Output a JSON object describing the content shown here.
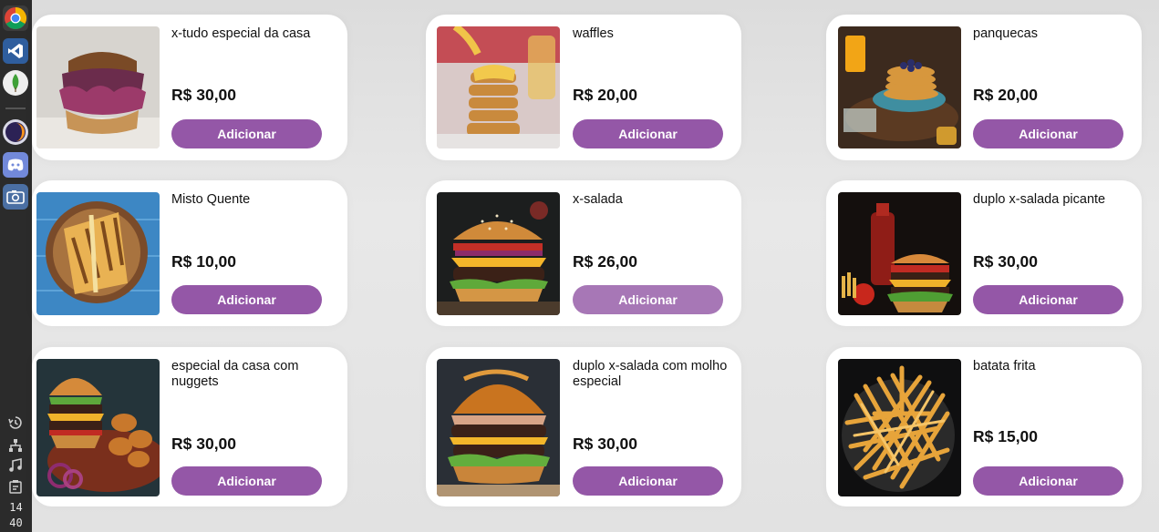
{
  "clock": {
    "hour": "14",
    "minute": "40"
  },
  "dock": {
    "apps": [
      {
        "name": "chrome-icon"
      },
      {
        "name": "vscode-icon"
      },
      {
        "name": "mongodb-icon"
      },
      {
        "name": "eclipse-icon"
      },
      {
        "name": "discord-icon"
      },
      {
        "name": "screenshot-icon"
      }
    ],
    "system": [
      {
        "name": "history-icon"
      },
      {
        "name": "network-icon"
      },
      {
        "name": "music-icon"
      },
      {
        "name": "clipboard-icon"
      }
    ]
  },
  "products": [
    {
      "name": "x-tudo especial da casa",
      "price": "R$ 30,00",
      "button": "Adicionar",
      "image": "burger-purple-slaw"
    },
    {
      "name": "waffles",
      "price": "R$ 20,00",
      "button": "Adicionar",
      "image": "waffle-stack-syrup"
    },
    {
      "name": "panquecas",
      "price": "R$ 20,00",
      "button": "Adicionar",
      "image": "pancakes-blueberries"
    },
    {
      "name": "Misto Quente",
      "price": "R$ 10,00",
      "button": "Adicionar",
      "image": "grilled-sandwich"
    },
    {
      "name": "x-salada",
      "price": "R$ 26,00",
      "button": "Adicionar",
      "image": "cheeseburger-salad"
    },
    {
      "name": "duplo x-salada picante",
      "price": "R$ 30,00",
      "button": "Adicionar",
      "image": "double-burger-hot-sauce"
    },
    {
      "name": "especial da casa com nuggets",
      "price": "R$ 30,00",
      "button": "Adicionar",
      "image": "burger-with-nuggets"
    },
    {
      "name": "duplo x-salada com molho especial",
      "price": "R$ 30,00",
      "button": "Adicionar",
      "image": "double-burger-special-sauce"
    },
    {
      "name": "batata frita",
      "price": "R$ 15,00",
      "button": "Adicionar",
      "image": "french-fries"
    }
  ],
  "colors": {
    "button": "#9457a7",
    "button_hover": "#a777b6",
    "card": "#ffffff",
    "background": "#e6e6e6",
    "dock": "#2b2b2b"
  }
}
